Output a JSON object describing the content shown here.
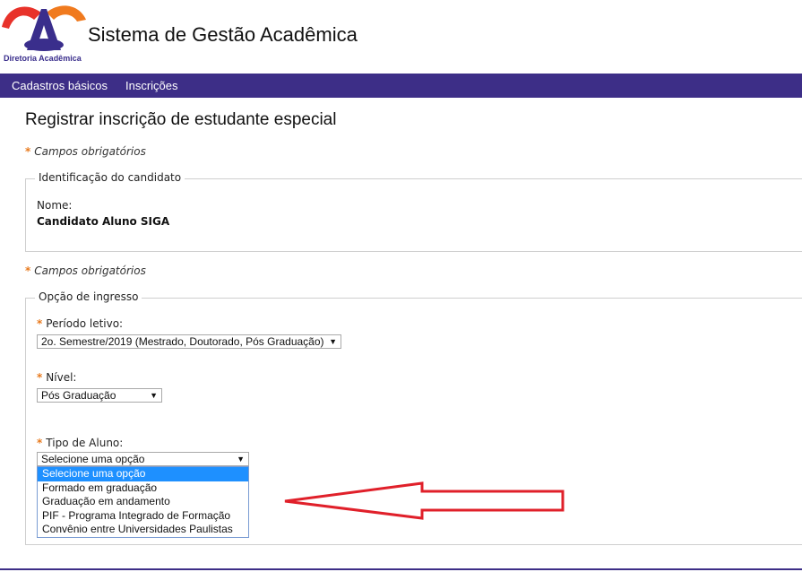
{
  "header": {
    "logo_caption": "Diretoria Acadêmica",
    "app_title": "Sistema de Gestão Acadêmica"
  },
  "nav": {
    "items": [
      {
        "label": "Cadastros básicos"
      },
      {
        "label": "Inscrições"
      }
    ]
  },
  "page": {
    "title": "Registrar inscrição de estudante especial",
    "required_note": "Campos obrigatórios"
  },
  "identification": {
    "legend": "Identificação do candidato",
    "name_label": "Nome:",
    "name_value": "Candidato Aluno SIGA"
  },
  "ingress": {
    "legend": "Opção de ingresso",
    "period_label": "Período letivo:",
    "period_value": "2o. Semestre/2019 (Mestrado, Doutorado, Pós Graduação)",
    "level_label": "Nível:",
    "level_value": "Pós Graduação",
    "student_type_label": "Tipo de Aluno:",
    "student_type_value": "Selecione uma opção",
    "student_type_options": [
      "Selecione uma opção",
      "Formado em graduação",
      "Graduação em andamento",
      "PIF - Programa Integrado de Formação",
      "Convênio entre Universidades Paulistas"
    ]
  },
  "colors": {
    "brand": "#3d2e87",
    "required_star": "#e87a1e",
    "selected_option": "#1e90ff",
    "annotation_arrow": "#e0202a"
  },
  "icons": {
    "dropdown": "chevron-down-icon",
    "required": "asterisk-icon",
    "annotation": "red-arrow-annotation"
  }
}
